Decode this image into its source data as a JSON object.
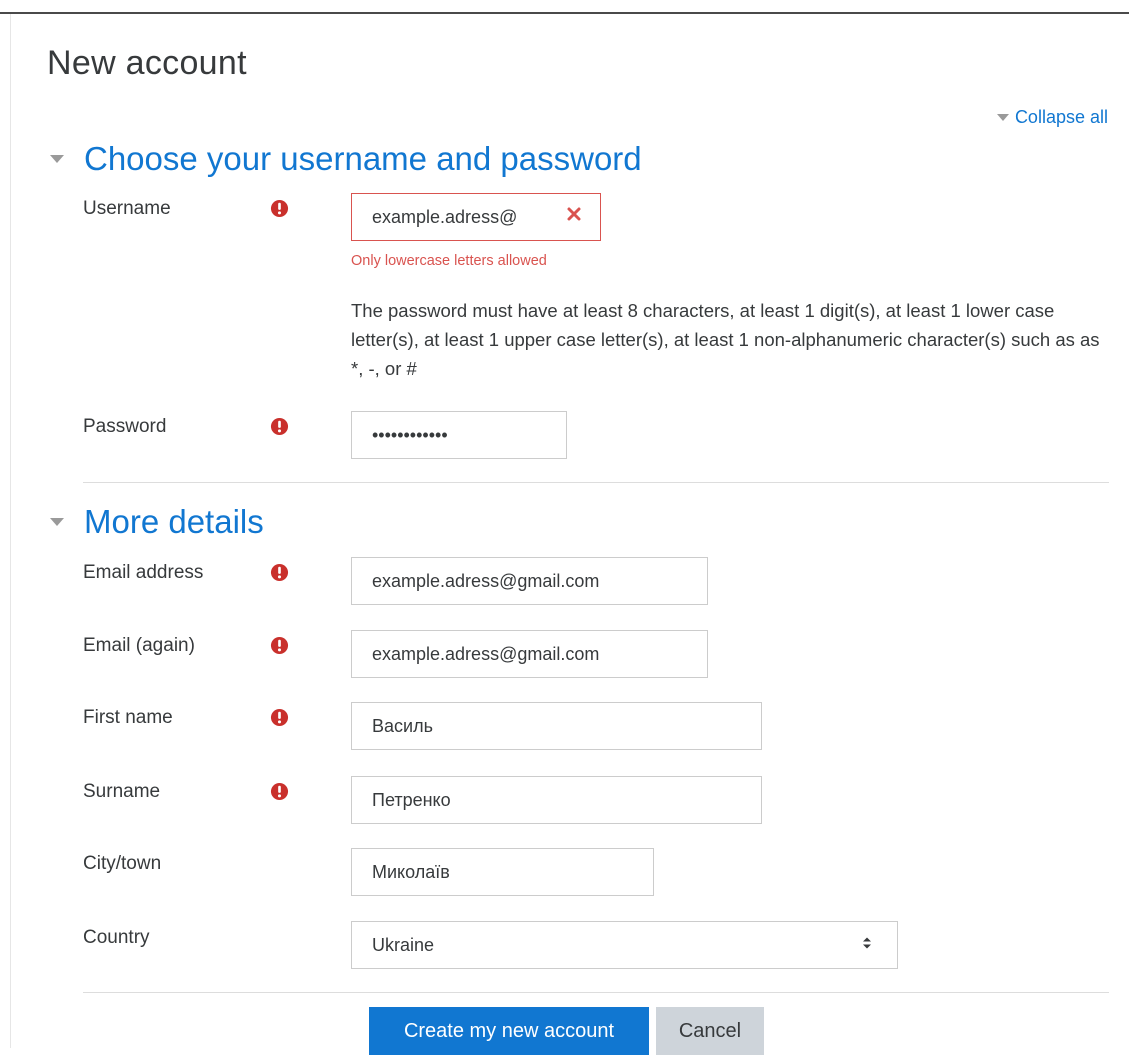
{
  "page": {
    "title": "New account",
    "collapse_all": "Collapse all"
  },
  "sections": {
    "credentials": {
      "title": "Choose your username and password"
    },
    "details": {
      "title": "More details"
    }
  },
  "username": {
    "label": "Username",
    "value": "example.adress@",
    "error": "Only lowercase letters allowed"
  },
  "password": {
    "rules": "The password must have at least 8 characters, at least 1 digit(s), at least 1 lower case letter(s), at least 1 upper case letter(s), at least 1 non-alphanumeric character(s) such as as *, -, or #",
    "label": "Password",
    "value": "••••••••••••"
  },
  "email": {
    "label": "Email address",
    "value": "example.adress@gmail.com"
  },
  "email_again": {
    "label": "Email (again)",
    "value": "example.adress@gmail.com"
  },
  "firstname": {
    "label": "First name",
    "value": "Василь"
  },
  "surname": {
    "label": "Surname",
    "value": "Петренко"
  },
  "city": {
    "label": "City/town",
    "value": "Миколаїв"
  },
  "country": {
    "label": "Country",
    "value": "Ukraine"
  },
  "buttons": {
    "submit": "Create my new account",
    "cancel": "Cancel"
  },
  "colors": {
    "accent": "#1177d1",
    "error": "#d9534f",
    "required_icon": "#c9302c",
    "secondary_button": "#ced4da"
  }
}
